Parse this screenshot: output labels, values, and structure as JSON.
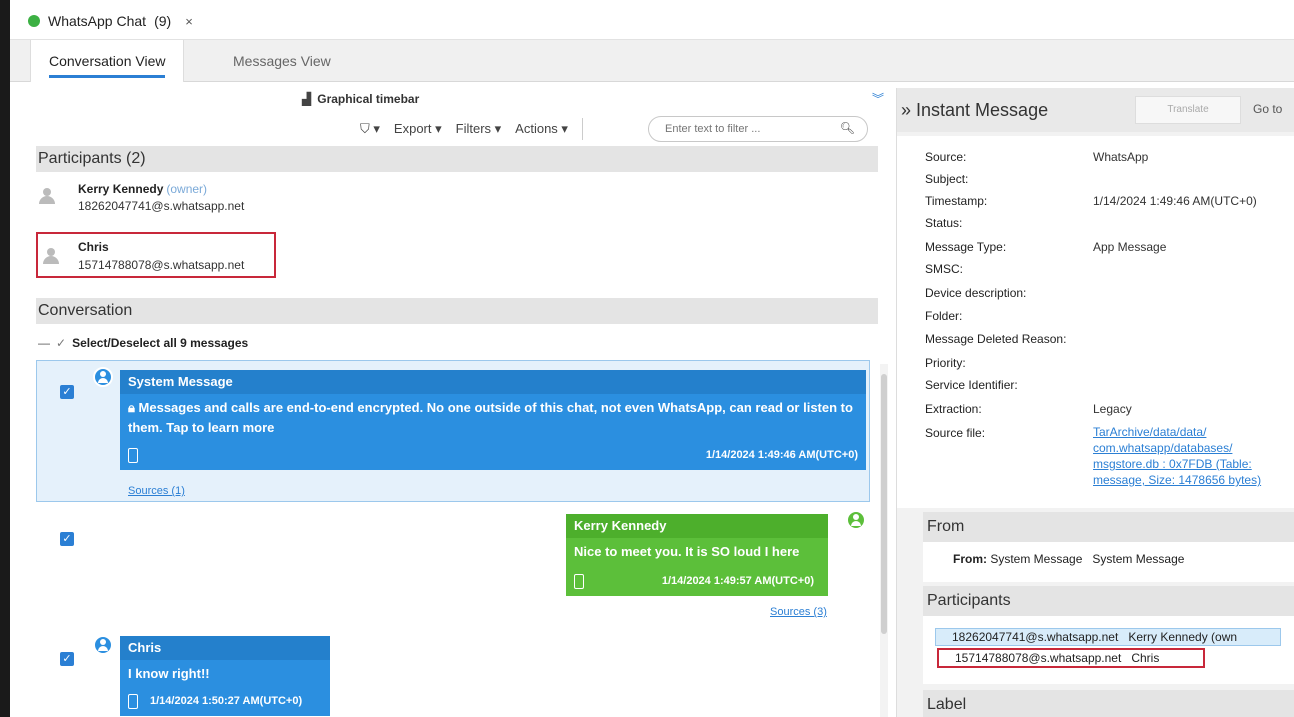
{
  "doc_tab": {
    "title": "WhatsApp Chat",
    "count": "(9)",
    "close": "×"
  },
  "view_tabs": [
    {
      "label": "Conversation View"
    },
    {
      "label": "Messages View"
    }
  ],
  "timebar": {
    "label": "Graphical timebar"
  },
  "toolbar": {
    "tag_label": "▾",
    "export_label": "Export ▾",
    "filters_label": "Filters ▾",
    "actions_label": "Actions ▾",
    "filter_placeholder": "Enter text to filter ..."
  },
  "participants": {
    "header": "Participants (2)",
    "items": [
      {
        "name": "Kerry Kennedy",
        "role": "(owner)",
        "id": "18262047741@s.whatsapp.net"
      },
      {
        "name": "Chris",
        "role": "",
        "id": "15714788078@s.whatsapp.net"
      }
    ]
  },
  "conversation": {
    "header": "Conversation",
    "select_all": "Select/Deselect all 9 messages",
    "messages": [
      {
        "sender": "System Message",
        "text": "Messages and calls are end-to-end encrypted. No one outside of this chat, not even WhatsApp, can read or listen to them. Tap to learn more",
        "timestamp": "1/14/2024 1:49:46 AM(UTC+0)",
        "sources": "Sources (1)"
      },
      {
        "sender": "Kerry Kennedy",
        "text": "Nice to meet you. It is SO loud I here",
        "timestamp": "1/14/2024 1:49:57 AM(UTC+0)",
        "sources": "Sources (3)"
      },
      {
        "sender": "Chris",
        "text": "I know right!!",
        "timestamp": "1/14/2024 1:50:27 AM(UTC+0)",
        "sources": ""
      }
    ]
  },
  "instant_message": {
    "title": "» Instant Message",
    "translate": "Translate",
    "goto": "Go to",
    "properties": [
      {
        "label": "Source:",
        "value": "WhatsApp"
      },
      {
        "label": "Subject:",
        "value": ""
      },
      {
        "label": "Timestamp:",
        "value": "1/14/2024 1:49:46 AM(UTC+0)"
      },
      {
        "label": "Status:",
        "value": ""
      },
      {
        "label": "Message Type:",
        "value": "App Message"
      },
      {
        "label": "SMSC:",
        "value": ""
      },
      {
        "label": "Device description:",
        "value": ""
      },
      {
        "label": "Folder:",
        "value": ""
      },
      {
        "label": "Message Deleted Reason:",
        "value": ""
      },
      {
        "label": "Priority:",
        "value": ""
      },
      {
        "label": "Service Identifier:",
        "value": ""
      },
      {
        "label": "Extraction:",
        "value": "Legacy"
      },
      {
        "label": "Source file:",
        "value": ""
      }
    ],
    "source_file_lines": [
      "TarArchive/data/data/",
      "com.whatsapp/databases/",
      "msgstore.db : 0x7FDB (Table:",
      "message, Size: 1478656 bytes)"
    ]
  },
  "from_section": {
    "header": "From",
    "label": "From:",
    "value1": "System Message",
    "value2": "System Message"
  },
  "right_participants": {
    "header": "Participants",
    "rows": [
      {
        "id": "18262047741@s.whatsapp.net",
        "name": "Kerry Kennedy (own"
      },
      {
        "id": "15714788078@s.whatsapp.net",
        "name": "Chris"
      }
    ]
  },
  "label_section": {
    "header": "Label"
  },
  "colors": {
    "accent": "#2b7fd4",
    "bubble_blue": "#2b8fe0",
    "bubble_green": "#5cbf3a",
    "highlight_red": "#c8283a"
  }
}
